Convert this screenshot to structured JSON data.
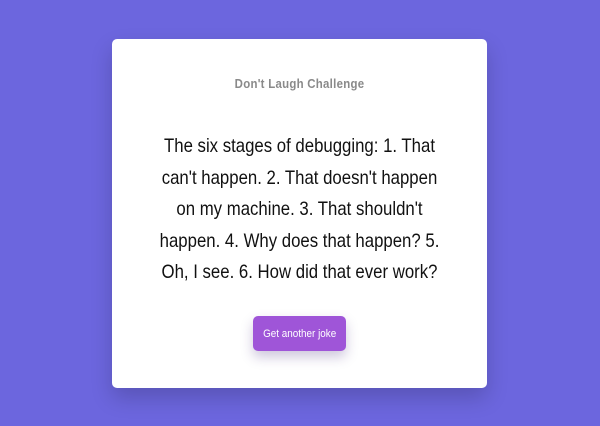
{
  "app": {
    "title": "Don't Laugh Challenge"
  },
  "joke": {
    "text": "The six stages of debugging: 1. That can't happen. 2. That doesn't happen on my machine. 3. That shouldn't happen. 4. Why does that happen? 5. Oh, I see. 6. How did that ever work?"
  },
  "actions": {
    "next_label": "Get another joke"
  },
  "colors": {
    "background": "#6c66de",
    "card": "#ffffff",
    "button": "#9f55d8"
  }
}
